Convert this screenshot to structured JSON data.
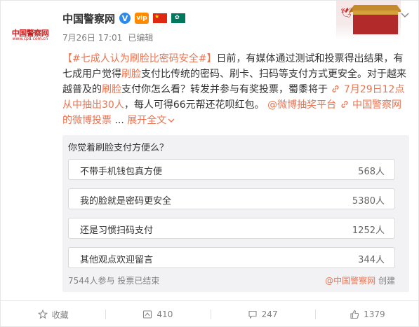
{
  "author": {
    "name": "中国警察网",
    "avatar_text": "中国警察网",
    "avatar_sub": "www.cpd.com.cn",
    "verified_mark": "V",
    "vip_badge": "vip"
  },
  "meta": {
    "time": "7月26日 17:01",
    "edited": "已编辑"
  },
  "post": {
    "open_bracket": "【",
    "topic": "#七成人认为刷脸比密码安全#",
    "close_bracket": "】",
    "text1": "日前，有媒体通过测试和投票得出结果，有七成用户觉得",
    "kw1": "刷脸",
    "text2": "支付比传统的密码、刷卡、扫码等支付方式更安全。对于越来越普及的",
    "kw2": "刷脸",
    "text3": "支付你怎么看？转发并参与有奖投票，蜀黍将于",
    "lottery_link": "7月29日12点从中抽出30人",
    "text4": "，每人可得66元帮还花呗红包。",
    "mention_link": "@微博抽奖平台",
    "vote_link": "中国警察网的微博投票",
    "ellipsis": "...",
    "expand": "展开全文",
    "expand_icon": "chevron-down"
  },
  "poll": {
    "question": "你觉着刷脸支付方便么？",
    "options": [
      {
        "label": "不带手机钱包真方便",
        "count": "568人"
      },
      {
        "label": "我的脸就是密码更安全",
        "count": "5380人"
      },
      {
        "label": "还是习惯扫码支付",
        "count": "1252人"
      },
      {
        "label": "其他观点欢迎留言",
        "count": "344人"
      }
    ],
    "footer_left": "7544人参与 投票已结束",
    "creator": "@中国警察网",
    "created_label": "创建"
  },
  "actions": {
    "favorite": "收藏",
    "repost": "410",
    "comment": "247",
    "like": "1379"
  },
  "colors": {
    "accent": "#eb7350",
    "text": "#333333",
    "muted": "#808080",
    "poll_bg": "#f2f2f5"
  }
}
